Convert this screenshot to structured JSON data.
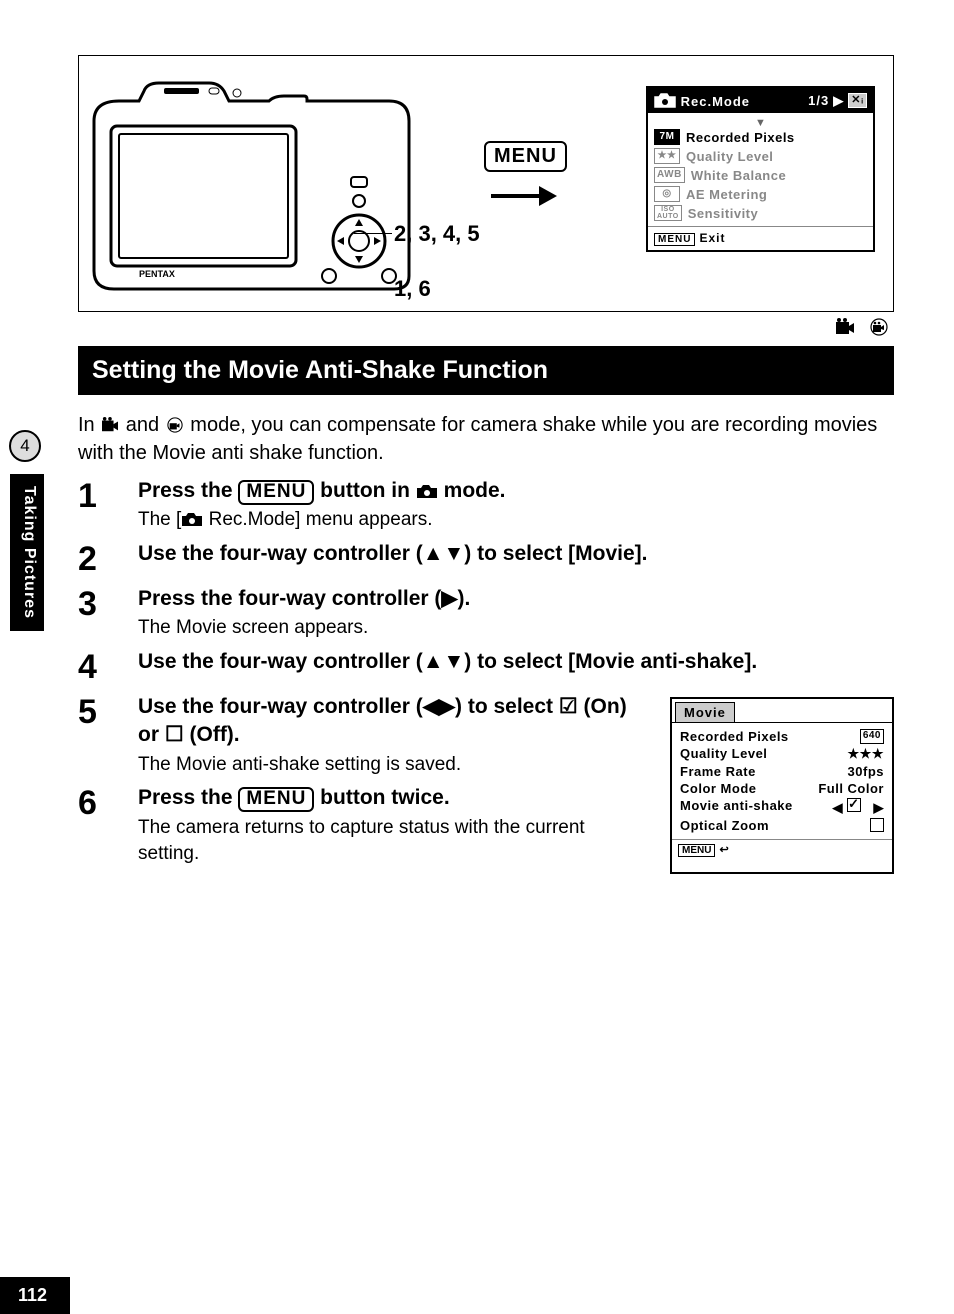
{
  "page_number": "112",
  "chapter_number": "4",
  "chapter_name": "Taking Pictures",
  "illustration": {
    "menu_label": "MENU",
    "callout_steps_top": "2, 3, 4, 5",
    "callout_steps_bottom": "1, 6",
    "brand": "PENTAX",
    "screen": {
      "title": "Rec.Mode",
      "page_indicator": "1/3",
      "items": [
        {
          "icon": "7M",
          "label": "Recorded Pixels",
          "selected": true
        },
        {
          "icon": "★★",
          "label": "Quality Level"
        },
        {
          "icon": "AWB",
          "label": "White Balance"
        },
        {
          "icon": "◎",
          "label": "AE Metering"
        },
        {
          "icon": "ISO",
          "label": "Sensitivity"
        }
      ],
      "footer_button": "MENU",
      "footer_label": "Exit"
    }
  },
  "mode_icons_note": "movie-mode and underwater-movie-mode icons",
  "section_title": "Setting the Movie Anti-Shake Function",
  "intro_prefix": "In ",
  "intro_mid": " and ",
  "intro_suffix": " mode, you can compensate for camera shake while you are recording movies with the Movie anti shake function.",
  "steps": [
    {
      "n": "1",
      "title_parts": [
        "Press the ",
        "MENU",
        " button in ",
        "CAMERA_ICON",
        " mode."
      ],
      "desc_parts": [
        "The [",
        "CAMERA_ICON",
        " Rec.Mode] menu appears."
      ]
    },
    {
      "n": "2",
      "title_plain": "Use the four-way controller (▲▼) to select [Movie]."
    },
    {
      "n": "3",
      "title_plain": "Press the four-way controller (▶).",
      "desc_plain": "The Movie screen appears."
    },
    {
      "n": "4",
      "title_plain": "Use the four-way controller (▲▼) to select [Movie anti-shake]."
    },
    {
      "n": "5",
      "title_plain": "Use the four-way controller (◀▶) to select ☑ (On) or ☐ (Off).",
      "desc_plain": "The Movie anti-shake setting is saved."
    },
    {
      "n": "6",
      "title_parts": [
        "Press the ",
        "MENU",
        " button twice."
      ],
      "desc_plain": "The camera returns to capture status with the current setting."
    }
  ],
  "movie_screen": {
    "tab": "Movie",
    "rows": [
      {
        "label": "Recorded Pixels",
        "value": "640",
        "box": true
      },
      {
        "label": "Quality Level",
        "value": "★★★"
      },
      {
        "label": "Frame Rate",
        "value": "30fps"
      },
      {
        "label": "Color Mode",
        "value": "Full Color"
      },
      {
        "label": "Movie anti-shake",
        "value": "CHECK_ON",
        "selected": true,
        "arrows": true
      },
      {
        "label": "Optical Zoom",
        "value": "CHECK_OFF"
      }
    ],
    "footer_button": "MENU",
    "footer_icon": "↩"
  }
}
